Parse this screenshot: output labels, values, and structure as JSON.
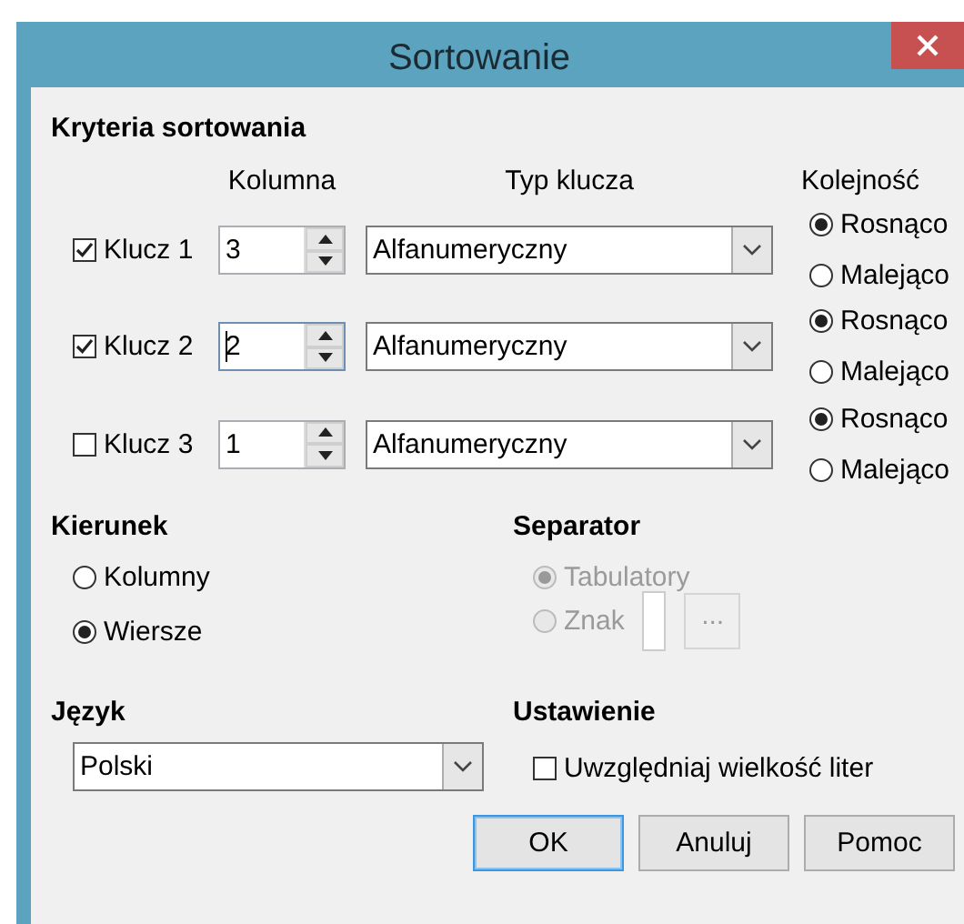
{
  "window": {
    "title": "Sortowanie"
  },
  "criteria": {
    "heading": "Kryteria sortowania",
    "column_headers": [
      "Kolumna",
      "Typ klucza",
      "Kolejność"
    ],
    "keys": [
      {
        "label": "Klucz 1",
        "checked": true,
        "column": {
          "value": "3",
          "focused": false
        },
        "type": "Alfanumeryczny",
        "order": [
          {
            "label": "Rosnąco",
            "selected": true
          },
          {
            "label": "Malejąco",
            "selected": false
          }
        ]
      },
      {
        "label": "Klucz 2",
        "checked": true,
        "column": {
          "value": "2",
          "focused": true
        },
        "type": "Alfanumeryczny",
        "order": [
          {
            "label": "Rosnąco",
            "selected": true
          },
          {
            "label": "Malejąco",
            "selected": false
          }
        ]
      },
      {
        "label": "Klucz 3",
        "checked": false,
        "column": {
          "value": "1",
          "focused": false
        },
        "type": "Alfanumeryczny",
        "order": [
          {
            "label": "Rosnąco",
            "selected": true
          },
          {
            "label": "Malejąco",
            "selected": false
          }
        ]
      }
    ]
  },
  "direction": {
    "heading": "Kierunek",
    "options": [
      {
        "label": "Kolumny",
        "selected": false
      },
      {
        "label": "Wiersze",
        "selected": true
      }
    ]
  },
  "separator": {
    "heading": "Separator",
    "disabled": true,
    "options": [
      {
        "label": "Tabulatory",
        "selected": true
      },
      {
        "label": "Znak",
        "selected": false
      }
    ],
    "browse_button": "..."
  },
  "language": {
    "heading": "Język",
    "value": "Polski"
  },
  "settings": {
    "heading": "Ustawienie",
    "case_sensitive": {
      "label": "Uwzględniaj wielkość liter",
      "checked": false
    }
  },
  "buttons": [
    {
      "label": "OK",
      "focused": true
    },
    {
      "label": "Anuluj",
      "focused": false
    },
    {
      "label": "Pomoc",
      "focused": false
    }
  ]
}
